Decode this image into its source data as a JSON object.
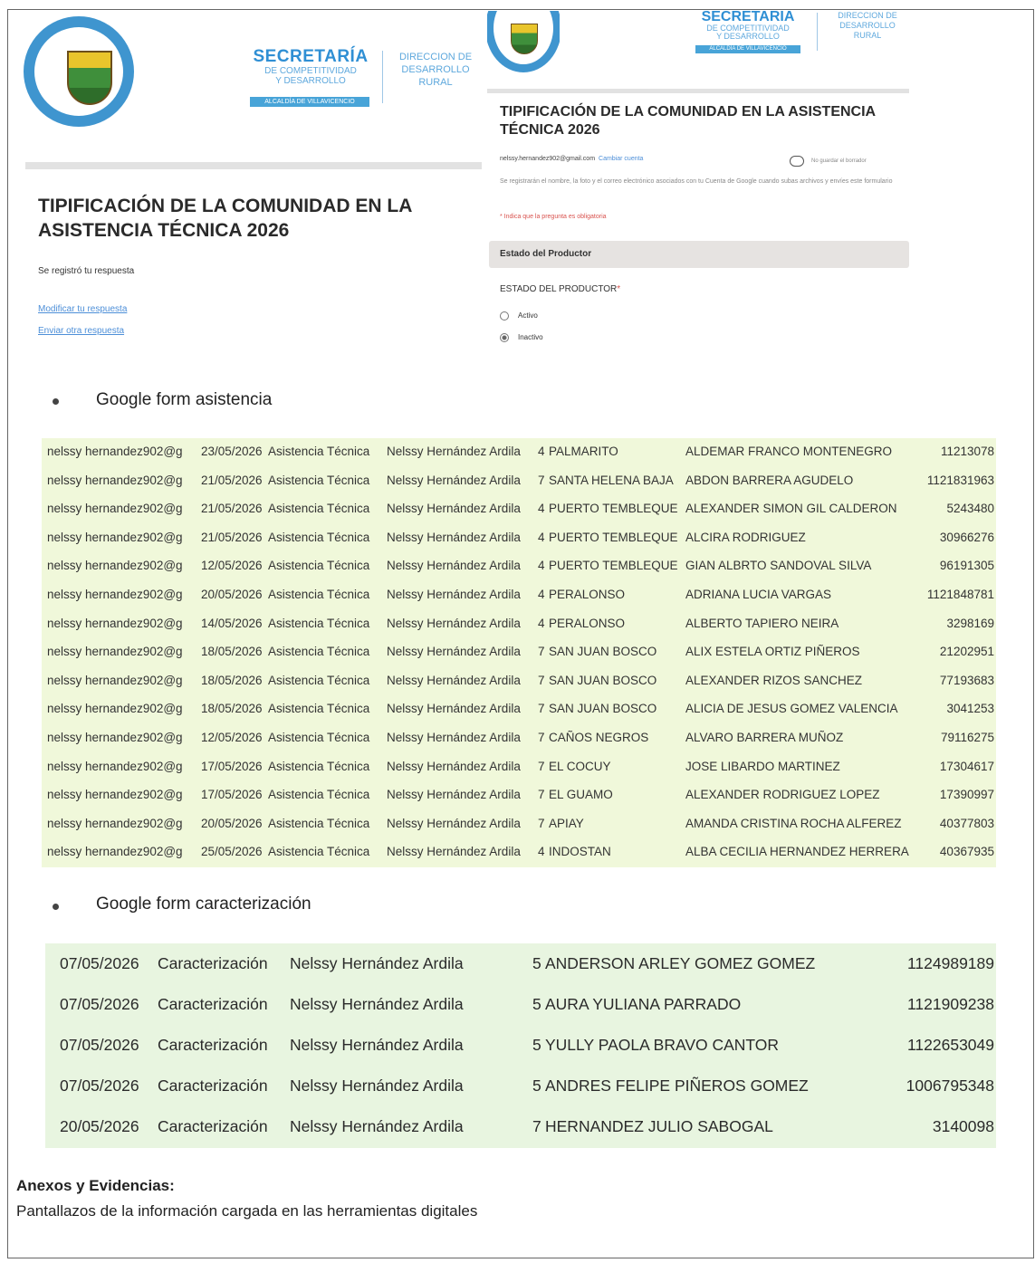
{
  "left_form": {
    "logo_alt": "Alcaldía de Villavicencio seal",
    "secretaria_title": "SECRETARÍA",
    "secretaria_sub1": "DE COMPETITIVIDAD",
    "secretaria_sub2": "Y DESARROLLO",
    "secretaria_bar": "ALCALDÍA DE VILLAVICENCIO",
    "direccion1": "DIRECCION DE",
    "direccion2": "DESARROLLO",
    "direccion3": "RURAL",
    "title": "TIPIFICACIÓN DE LA COMUNIDAD EN LA ASISTENCIA TÉCNICA 2026",
    "registered": "Se registró tu respuesta",
    "modify_link": "Modificar tu respuesta",
    "send_other_link": "Enviar otra respuesta"
  },
  "right_form": {
    "secretaria_title": "SECRETARIA",
    "secretaria_sub1": "DE COMPETITIVIDAD",
    "secretaria_sub2": "Y DESARROLLO",
    "secretaria_bar": "ALCALDÍA DE VILLAVICENCIO",
    "direccion1": "DIRECCION DE",
    "direccion2": "DESARROLLO",
    "direccion3": "RURAL",
    "title": "TIPIFICACIÓN DE LA COMUNIDAD EN LA ASISTENCIA TÉCNICA 2026",
    "email": "nelssy.hernandez902@gmail.com",
    "change_account": "Cambiar cuenta",
    "saved_note": "No guardar el borrador",
    "info_note": "Se registrarán el nombre, la foto y el correo electrónico asociados con tu Cuenta de Google cuando subas archivos y envíes este formulario",
    "required_note": "* Indica que la pregunta es obligatoria",
    "section_title": "Estado del Productor",
    "question": "ESTADO DEL PRODUCTOR",
    "required_mark": "*",
    "option1": "Activo",
    "option2": "Inactivo",
    "selected_option": "Inactivo",
    "cloud_icon": "cloud-icon"
  },
  "sections": {
    "asistencia_label": "Google form asistencia",
    "caracterizacion_label": "Google form caracterización"
  },
  "asistencia_rows": [
    {
      "email": "nelssy hernandez902@g",
      "date": "23/05/2026",
      "type": "Asistencia Técnica",
      "tech": "Nelssy Hernández Ardila",
      "num": "4",
      "vereda": "PALMARITO",
      "name": "ALDEMAR FRANCO MONTENEGRO",
      "id": "11213078"
    },
    {
      "email": "nelssy hernandez902@g",
      "date": "21/05/2026",
      "type": "Asistencia Técnica",
      "tech": "Nelssy Hernández Ardila",
      "num": "7",
      "vereda": "SANTA HELENA BAJA",
      "name": "ABDON BARRERA AGUDELO",
      "id": "1121831963"
    },
    {
      "email": "nelssy hernandez902@g",
      "date": "21/05/2026",
      "type": "Asistencia Técnica",
      "tech": "Nelssy Hernández Ardila",
      "num": "4",
      "vereda": "PUERTO TEMBLEQUE",
      "name": "ALEXANDER SIMON GIL CALDERON",
      "id": "5243480"
    },
    {
      "email": "nelssy hernandez902@g",
      "date": "21/05/2026",
      "type": "Asistencia Técnica",
      "tech": "Nelssy Hernández Ardila",
      "num": "4",
      "vereda": "PUERTO TEMBLEQUE",
      "name": "ALCIRA RODRIGUEZ",
      "id": "30966276"
    },
    {
      "email": "nelssy hernandez902@g",
      "date": "12/05/2026",
      "type": "Asistencia Técnica",
      "tech": "Nelssy Hernández Ardila",
      "num": "4",
      "vereda": "PUERTO TEMBLEQUE",
      "name": "GIAN ALBRTO SANDOVAL SILVA",
      "id": "96191305"
    },
    {
      "email": "nelssy hernandez902@g",
      "date": "20/05/2026",
      "type": "Asistencia Técnica",
      "tech": "Nelssy Hernández Ardila",
      "num": "4",
      "vereda": "PERALONSO",
      "name": "ADRIANA LUCIA VARGAS",
      "id": "1121848781"
    },
    {
      "email": "nelssy hernandez902@g",
      "date": "14/05/2026",
      "type": "Asistencia Técnica",
      "tech": "Nelssy Hernández Ardila",
      "num": "4",
      "vereda": "PERALONSO",
      "name": "ALBERTO TAPIERO  NEIRA",
      "id": "3298169"
    },
    {
      "email": "nelssy hernandez902@g",
      "date": "18/05/2026",
      "type": "Asistencia Técnica",
      "tech": "Nelssy Hernández Ardila",
      "num": "7",
      "vereda": "SAN JUAN BOSCO",
      "name": "ALIX ESTELA ORTIZ PIÑEROS",
      "id": "21202951"
    },
    {
      "email": "nelssy hernandez902@g",
      "date": "18/05/2026",
      "type": "Asistencia Técnica",
      "tech": "Nelssy Hernández Ardila",
      "num": "7",
      "vereda": "SAN JUAN BOSCO",
      "name": "ALEXANDER RIZOS SANCHEZ",
      "id": "77193683"
    },
    {
      "email": "nelssy hernandez902@g",
      "date": "18/05/2026",
      "type": "Asistencia Técnica",
      "tech": "Nelssy Hernández Ardila",
      "num": "7",
      "vereda": "SAN JUAN BOSCO",
      "name": "ALICIA DE JESUS GOMEZ VALENCIA",
      "id": "3041253"
    },
    {
      "email": "nelssy hernandez902@g",
      "date": "12/05/2026",
      "type": "Asistencia Técnica",
      "tech": "Nelssy Hernández Ardila",
      "num": "7",
      "vereda": "CAÑOS NEGROS",
      "name": "ALVARO BARRERA MUÑOZ",
      "id": "79116275"
    },
    {
      "email": "nelssy hernandez902@g",
      "date": "17/05/2026",
      "type": "Asistencia Técnica",
      "tech": "Nelssy Hernández Ardila",
      "num": "7",
      "vereda": "EL COCUY",
      "name": "JOSE LIBARDO MARTINEZ",
      "id": "17304617"
    },
    {
      "email": "nelssy hernandez902@g",
      "date": "17/05/2026",
      "type": "Asistencia Técnica",
      "tech": "Nelssy Hernández Ardila",
      "num": "7",
      "vereda": "EL GUAMO",
      "name": "ALEXANDER RODRIGUEZ LOPEZ",
      "id": "17390997"
    },
    {
      "email": "nelssy hernandez902@g",
      "date": "20/05/2026",
      "type": "Asistencia Técnica",
      "tech": "Nelssy Hernández Ardila",
      "num": "7",
      "vereda": "APIAY",
      "name": "AMANDA CRISTINA ROCHA ALFEREZ",
      "id": "40377803"
    },
    {
      "email": "nelssy hernandez902@g",
      "date": "25/05/2026",
      "type": "Asistencia Técnica",
      "tech": "Nelssy Hernández Ardila",
      "num": "4",
      "vereda": "INDOSTAN",
      "name": "ALBA CECILIA HERNANDEZ HERRERA",
      "id": "40367935"
    }
  ],
  "caracterizacion_rows": [
    {
      "date": "07/05/2026",
      "type": "Caracterización",
      "tech": "Nelssy Hernández Ardila",
      "num": "5",
      "name": "ANDERSON ARLEY GOMEZ GOMEZ",
      "id": "1124989189"
    },
    {
      "date": "07/05/2026",
      "type": "Caracterización",
      "tech": "Nelssy Hernández Ardila",
      "num": "5",
      "name": "AURA YULIANA PARRADO",
      "id": "1121909238"
    },
    {
      "date": "07/05/2026",
      "type": "Caracterización",
      "tech": "Nelssy Hernández Ardila",
      "num": "5",
      "name": "YULLY PAOLA BRAVO CANTOR",
      "id": "1122653049"
    },
    {
      "date": "07/05/2026",
      "type": "Caracterización",
      "tech": "Nelssy Hernández Ardila",
      "num": "5",
      "name": "ANDRES FELIPE PIÑEROS GOMEZ",
      "id": "1006795348"
    },
    {
      "date": "20/05/2026",
      "type": "Caracterización",
      "tech": "Nelssy Hernández Ardila",
      "num": "7",
      "name": "HERNANDEZ JULIO SABOGAL",
      "id": "3140098"
    }
  ],
  "footer": {
    "anexos_title": "Anexos y Evidencias:",
    "anexos_text": "Pantallazos de la información cargada en las herramientas digitales"
  }
}
